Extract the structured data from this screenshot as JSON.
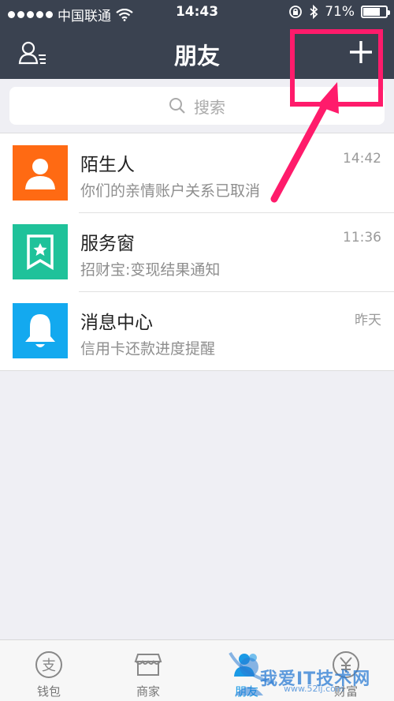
{
  "status_bar": {
    "carrier": "中国联通",
    "time": "14:43",
    "battery_percent": "71%",
    "battery_level": 0.71
  },
  "nav": {
    "title": "朋友",
    "left_icon": "contacts-list-icon",
    "right_icon": "plus-icon"
  },
  "search": {
    "placeholder": "搜索",
    "icon": "search-icon"
  },
  "messages": [
    {
      "title": "陌生人",
      "subtitle": "你们的亲情账户关系已取消",
      "time": "14:42",
      "icon": "person-icon",
      "color": "#ff6a13"
    },
    {
      "title": "服务窗",
      "subtitle": "招财宝:变现结果通知",
      "time": "11:36",
      "icon": "bookmark-star-icon",
      "color": "#1fc29a"
    },
    {
      "title": "消息中心",
      "subtitle": "信用卡还款进度提醒",
      "time": "昨天",
      "icon": "bell-icon",
      "color": "#13a9ef"
    }
  ],
  "tabbar": {
    "tabs": [
      {
        "label": "钱包",
        "icon": "wallet-icon"
      },
      {
        "label": "商家",
        "icon": "store-icon"
      },
      {
        "label": "朋友",
        "icon": "friends-icon",
        "active": true
      },
      {
        "label": "财富",
        "icon": "wealth-icon"
      }
    ]
  },
  "watermark": {
    "text": "我爱IT技术网",
    "url": "www.52ij.com"
  },
  "colors": {
    "nav_bg": "#3a4250",
    "annotation": "#ff1b6b",
    "active_tab": "#1a9ae6"
  }
}
